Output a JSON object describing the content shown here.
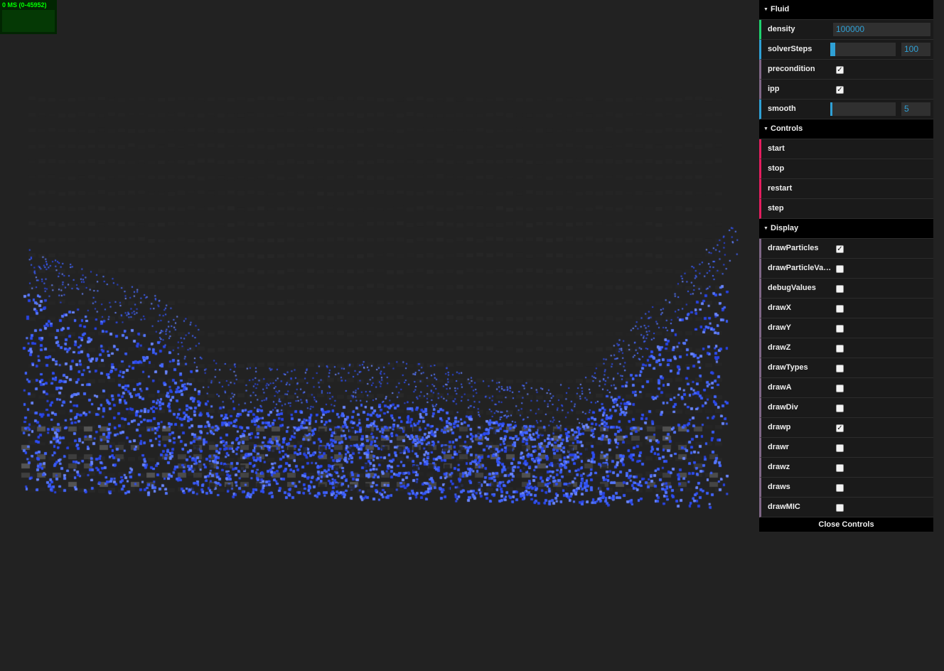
{
  "stats": {
    "text": "0 MS (0-45952)"
  },
  "gui": {
    "folders": [
      {
        "title": "Fluid",
        "rows": [
          {
            "label": "density",
            "type": "text",
            "value": "100000"
          },
          {
            "label": "solverSteps",
            "type": "number",
            "value": "100",
            "fraction": 0.08
          },
          {
            "label": "precondition",
            "type": "boolean",
            "checked": true
          },
          {
            "label": "ipp",
            "type": "boolean",
            "checked": true
          },
          {
            "label": "smooth",
            "type": "number",
            "value": "5",
            "fraction": 0.03
          }
        ]
      },
      {
        "title": "Controls",
        "rows": [
          {
            "label": "start",
            "type": "function"
          },
          {
            "label": "stop",
            "type": "function"
          },
          {
            "label": "restart",
            "type": "function"
          },
          {
            "label": "step",
            "type": "function"
          }
        ]
      },
      {
        "title": "Display",
        "rows": [
          {
            "label": "drawParticles",
            "type": "boolean",
            "checked": true
          },
          {
            "label": "drawParticleValues",
            "type": "boolean",
            "checked": false
          },
          {
            "label": "debugValues",
            "type": "boolean",
            "checked": false
          },
          {
            "label": "drawX",
            "type": "boolean",
            "checked": false
          },
          {
            "label": "drawY",
            "type": "boolean",
            "checked": false
          },
          {
            "label": "drawZ",
            "type": "boolean",
            "checked": false
          },
          {
            "label": "drawTypes",
            "type": "boolean",
            "checked": false
          },
          {
            "label": "drawA",
            "type": "boolean",
            "checked": false
          },
          {
            "label": "drawDiv",
            "type": "boolean",
            "checked": false
          },
          {
            "label": "drawp",
            "type": "boolean",
            "checked": true
          },
          {
            "label": "drawr",
            "type": "boolean",
            "checked": false
          },
          {
            "label": "drawz",
            "type": "boolean",
            "checked": false
          },
          {
            "label": "draws",
            "type": "boolean",
            "checked": false
          },
          {
            "label": "drawMIC",
            "type": "boolean",
            "checked": false
          }
        ]
      }
    ],
    "close_label": "Close Controls"
  },
  "colors": {
    "background": "#222222",
    "particle": "#3a5cf5",
    "particle_light": "#6b87ff",
    "grid_cell": "#5a5a5a",
    "number_accent": "#2fa1d6",
    "boolean_accent": "#806787",
    "function_accent": "#e61d5f",
    "stats_text": "#00ff00"
  }
}
